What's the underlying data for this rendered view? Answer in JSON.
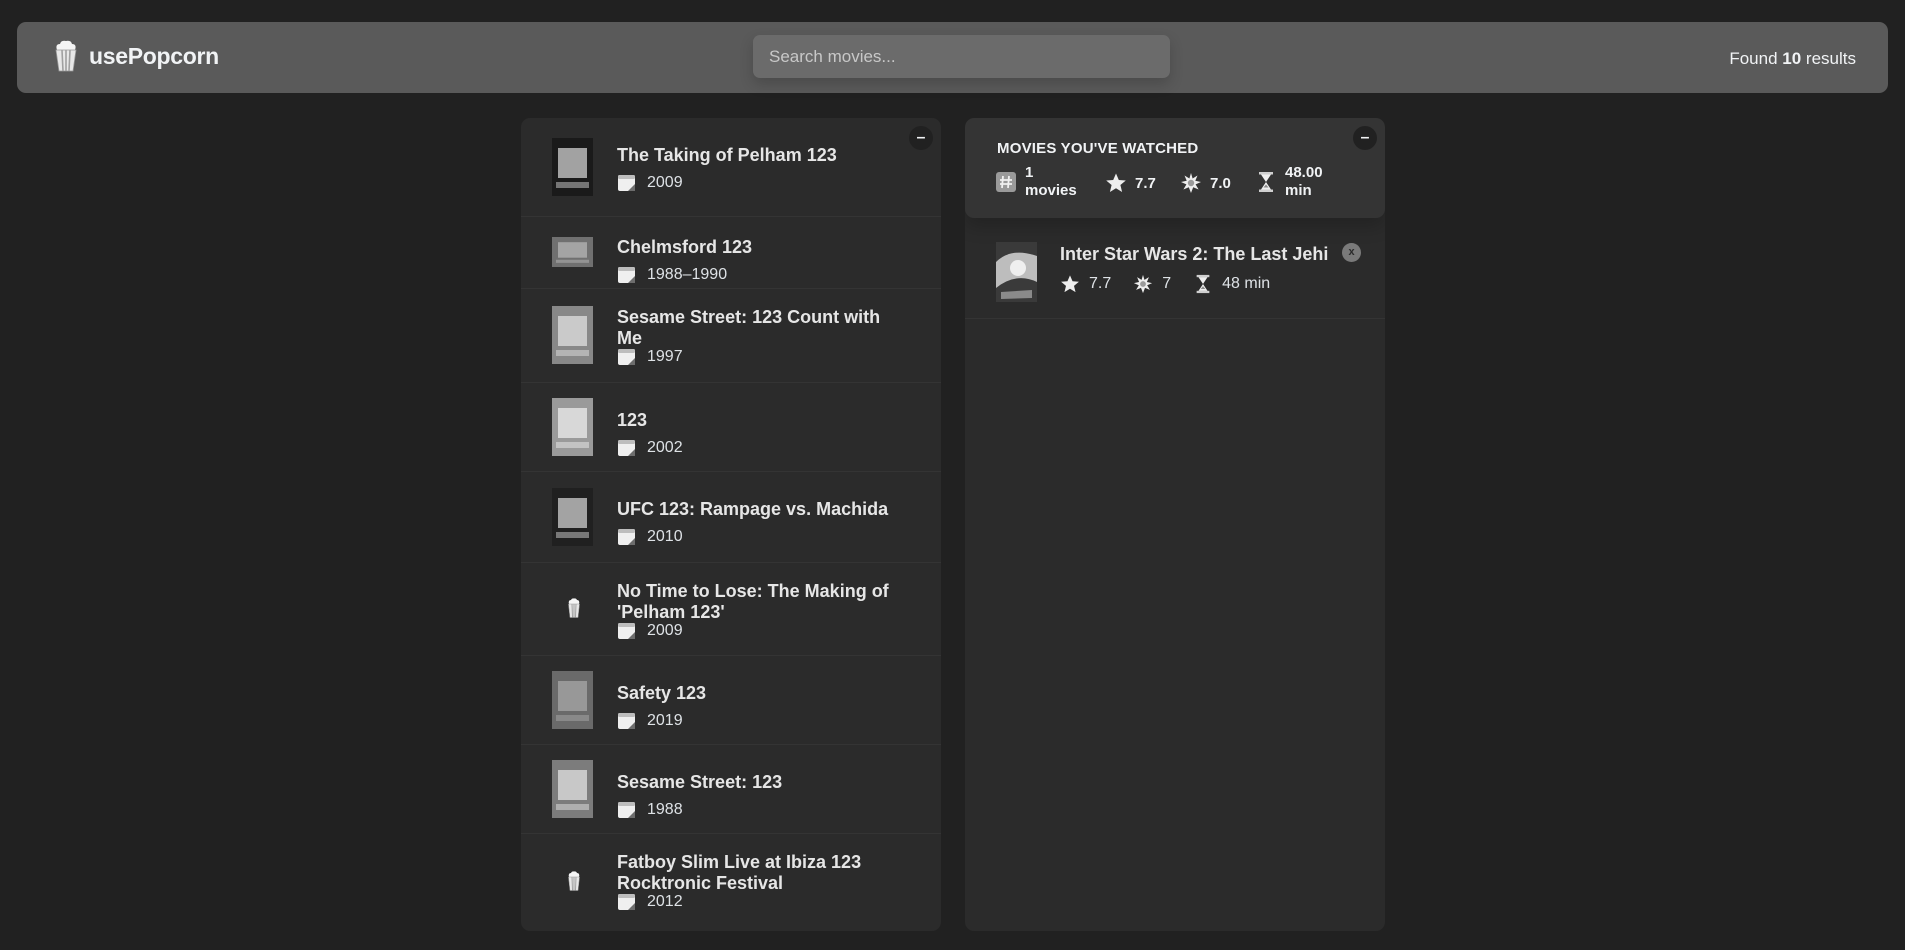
{
  "nav": {
    "logo_text": "usePopcorn",
    "search_placeholder": "Search movies...",
    "search_value": "",
    "results_prefix": "Found",
    "results_count": "10",
    "results_suffix": "results"
  },
  "left_box": {
    "toggle_label": "–",
    "movies": [
      {
        "title": "The Taking of Pelham 123",
        "year": "2009",
        "has_poster": true
      },
      {
        "title": "Chelmsford 123",
        "year": "1988–1990",
        "has_poster": true
      },
      {
        "title": "Sesame Street: 123 Count with Me",
        "year": "1997",
        "has_poster": true
      },
      {
        "title": "123",
        "year": "2002",
        "has_poster": true
      },
      {
        "title": "UFC 123: Rampage vs. Machida",
        "year": "2010",
        "has_poster": true
      },
      {
        "title": "No Time to Lose: The Making of 'Pelham 123'",
        "year": "2009",
        "has_poster": false
      },
      {
        "title": "Safety 123",
        "year": "2019",
        "has_poster": true
      },
      {
        "title": "Sesame Street: 123",
        "year": "1988",
        "has_poster": true
      },
      {
        "title": "Fatboy Slim Live at Ibiza 123 Rocktronic Festival",
        "year": "2012",
        "has_poster": false
      }
    ]
  },
  "right_box": {
    "toggle_label": "–",
    "summary": {
      "title": "MOVIES YOU'VE WATCHED",
      "count_num": "1",
      "count_unit": "movies",
      "imdb_rating": "7.7",
      "user_rating": "7.0",
      "runtime_num": "48.00",
      "runtime_unit": "min"
    },
    "watched": [
      {
        "title": "Inter Star Wars 2: The Last Jehi",
        "imdb_rating": "7.7",
        "user_rating": "7",
        "runtime": "48 min",
        "delete_label": "x"
      }
    ]
  },
  "icons": [
    "popcorn-icon",
    "calendar-icon",
    "hashtag-icon",
    "star-icon",
    "sparkle-icon",
    "hourglass-icon"
  ]
}
